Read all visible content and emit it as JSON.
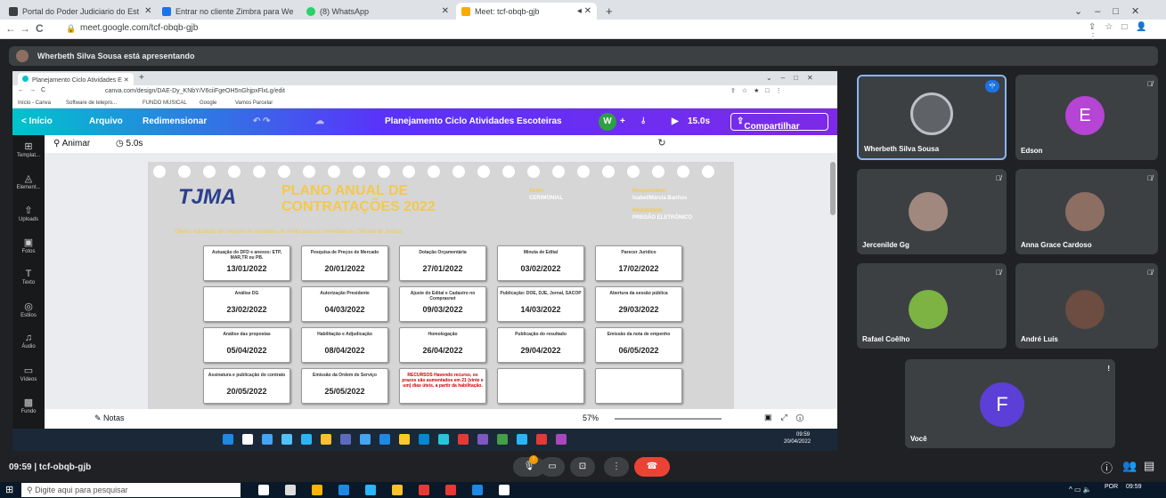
{
  "outer_tabs": [
    {
      "label": "Portal do Poder Judiciario do Est",
      "color": "#3c4043"
    },
    {
      "label": "Entrar no cliente Zimbra para We",
      "color": "#1a73e8"
    },
    {
      "label": "(8) WhatsApp",
      "color": "#25d366"
    },
    {
      "label": "Meet: tcf-obqb-gjb",
      "color": "#f9ab00"
    }
  ],
  "outer_url": "meet.google.com/tcf-obqb-gjb",
  "presenting": "Wherbeth Silva Sousa está apresentando",
  "inner": {
    "tab": "Planejamento Ciclo Atividades E",
    "url": "canva.com/design/DAE-Dy_KNbY/V6ciiFgeOH5nGhjpxFlxLg/edit",
    "bookmarks": [
      "Início - Canva",
      "Software de telepro...",
      "FUNDO MUSICAL",
      "Google",
      "Vamos Parcelar"
    ],
    "menu": {
      "home": "< Início",
      "file": "Arquivo",
      "resize": "Redimensionar",
      "title": "Planejamento Ciclo Atividades Escoteiras",
      "avatar": "W",
      "duration": "15.0s",
      "share": "Compartilhar"
    },
    "sidebar": [
      "Templat...",
      "Element...",
      "Uploads",
      "Fotos",
      "Texto",
      "Estilos",
      "Áudio",
      "Vídeos",
      "Fundo"
    ],
    "animate": "Animar",
    "time": "5.0s",
    "notes": "Notas",
    "zoom": "57%"
  },
  "slide": {
    "logo": "TJMA",
    "title1": "PLANO ANUAL DE",
    "title2": "CONTRATAÇÕES 2022",
    "setor_label": "Setor:",
    "setor": "CERIMONIAL",
    "resp_label": "Responsável:",
    "resp": "Isabel/Márcia Banhos",
    "mod_label": "Modalidade:",
    "mod": "PREGÃO ELETRÔNICO",
    "objeto": "Objeto: Aquisição de conjunto de medalhas de mérito para as cerimônias do Tribunal de Justiça.",
    "cards": [
      {
        "label": "Autuação do DFD e anexos: ETP, MAR,TR ou PB.",
        "date": "13/01/2022"
      },
      {
        "label": "Pesquisa de Preços de Mercado",
        "date": "20/01/2022"
      },
      {
        "label": "Dotação Orçamentária",
        "date": "27/01/2022"
      },
      {
        "label": "Minuta de Edital",
        "date": "03/02/2022"
      },
      {
        "label": "Parecer Jurídico",
        "date": "17/02/2022"
      },
      {
        "label": "Análise DG",
        "date": "23/02/2022"
      },
      {
        "label": "Autorização Presidente",
        "date": "04/03/2022"
      },
      {
        "label": "Ajuste do Edital e Cadastro no Comprasnet",
        "date": "09/03/2022"
      },
      {
        "label": "Publicação: DOE, DJE, Jornal, SACOP",
        "date": "14/03/2022"
      },
      {
        "label": "Abertura da sessão pública",
        "date": "29/03/2022"
      },
      {
        "label": "Análise das propostas",
        "date": "05/04/2022"
      },
      {
        "label": "Habilitação e Adjudicação",
        "date": "08/04/2022"
      },
      {
        "label": "Homologação",
        "date": "26/04/2022"
      },
      {
        "label": "Publicação do resultado",
        "date": "29/04/2022"
      },
      {
        "label": "Emissão da nota de empenho",
        "date": "06/05/2022"
      },
      {
        "label": "Assinatura e publicação do contrato",
        "date": "20/05/2022"
      },
      {
        "label": "Emissão da Ordem de Serviço",
        "date": "25/05/2022"
      },
      {
        "label": "RECURSOS Havendo recurso, os prazos são aumentados em 21 (vinte e um) dias úteis, a partir da habilitação.",
        "date": ""
      },
      {
        "label": "",
        "date": ""
      },
      {
        "label": "",
        "date": ""
      }
    ]
  },
  "inner_clock": {
    "time": "09:59",
    "date": "20/04/2022"
  },
  "participants": [
    {
      "name": "Wherbeth Silva Sousa",
      "initial": "",
      "color": "#5f6368"
    },
    {
      "name": "Edson",
      "initial": "E",
      "color": "#b644d4"
    },
    {
      "name": "Jercenilde Gg",
      "initial": "",
      "color": "#a1887f"
    },
    {
      "name": "Anna Grace Cardoso",
      "initial": "",
      "color": "#8d6e63"
    },
    {
      "name": "Rafael Coêlho",
      "initial": "",
      "color": "#7cb342"
    },
    {
      "name": "André Luís",
      "initial": "",
      "color": "#6d4c41"
    },
    {
      "name": "Você",
      "initial": "F",
      "color": "#5c3fd6"
    }
  ],
  "meeting": "09:59 | tcf-obqb-gjb",
  "taskbar": {
    "search": "Digite aqui para pesquisar",
    "lang": "POR",
    "time": "09:59"
  }
}
